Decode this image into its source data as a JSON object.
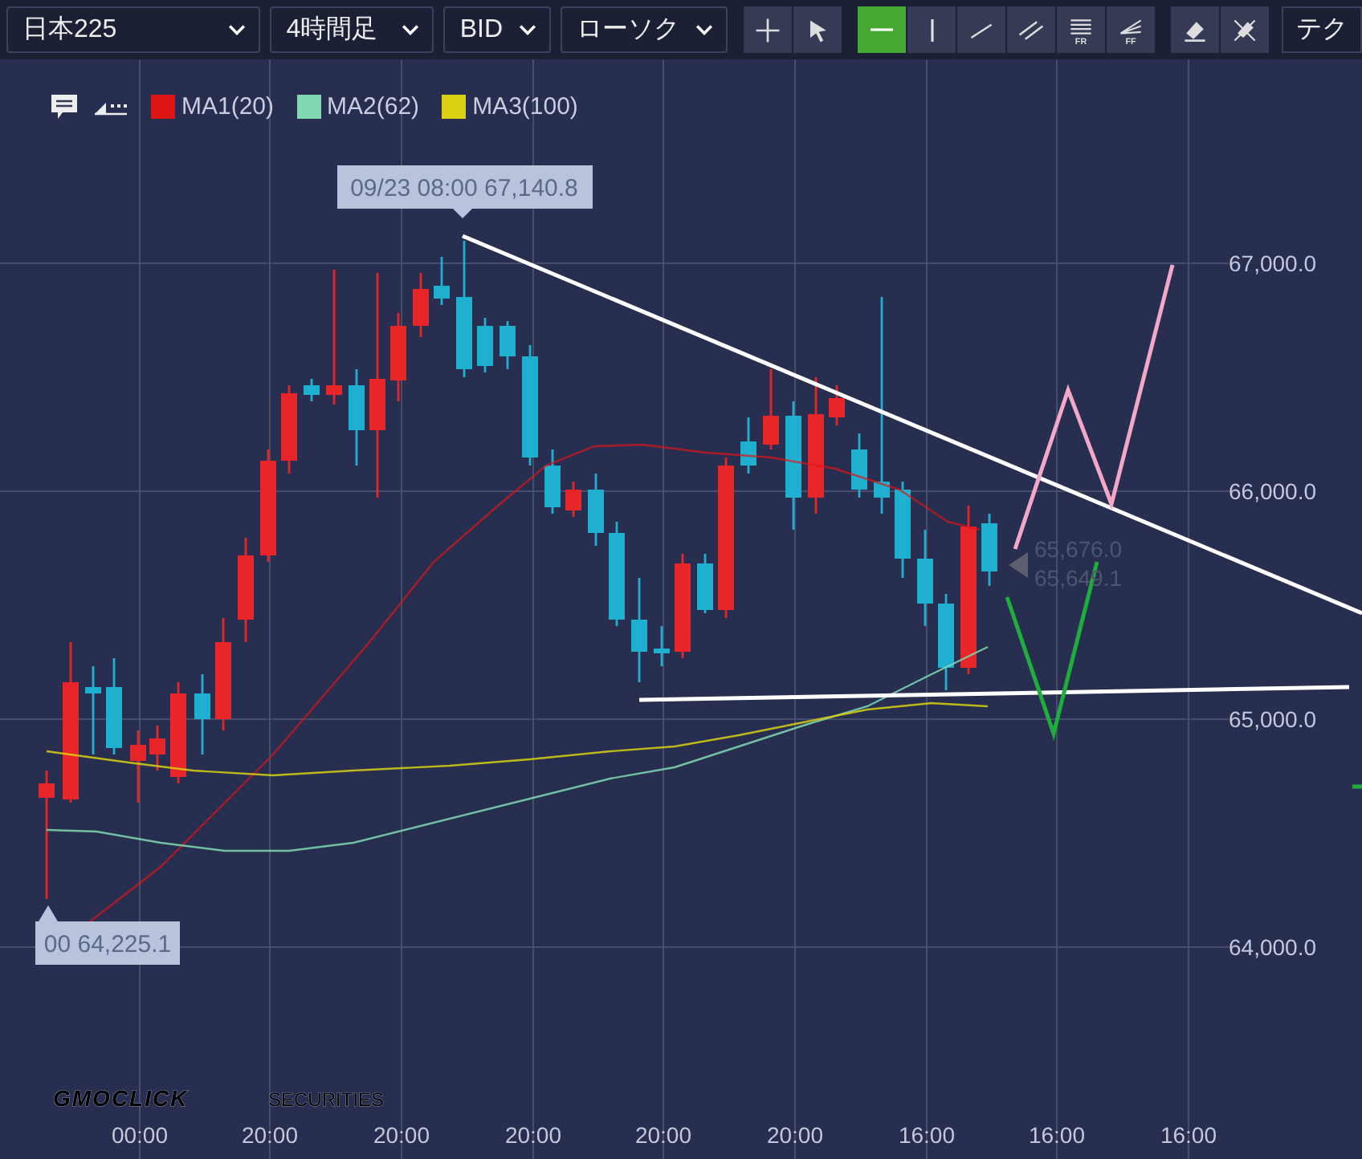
{
  "toolbar": {
    "dropdowns": [
      {
        "label": "日本225"
      },
      {
        "label": "4時間足"
      },
      {
        "label": "BID"
      },
      {
        "label": "ローソク"
      }
    ],
    "tool_groups": [
      {
        "tools": [
          {
            "kind": "crosshair",
            "selected": false
          },
          {
            "kind": "pointer",
            "selected": false
          }
        ]
      },
      {
        "tools": [
          {
            "kind": "hline",
            "selected": true
          },
          {
            "kind": "vline",
            "selected": false
          },
          {
            "kind": "trend",
            "selected": false
          },
          {
            "kind": "parallel",
            "selected": false
          },
          {
            "kind": "fibr",
            "label": "FR",
            "selected": false
          },
          {
            "kind": "fibf",
            "label": "FF",
            "selected": false
          }
        ]
      },
      {
        "tools": [
          {
            "kind": "eraser",
            "selected": false
          },
          {
            "kind": "clear",
            "selected": false
          }
        ]
      }
    ],
    "cut_button": {
      "label": "テク"
    }
  },
  "legend": [
    {
      "name": "MA1(20)",
      "color": "#e01515"
    },
    {
      "name": "MA2(62)",
      "color": "#7fd8b0"
    },
    {
      "name": "MA3(100)",
      "color": "#d8d010"
    }
  ],
  "chart": {
    "price_ticks": [
      "67,000.0",
      "66,000.0",
      "65,000.0",
      "64,000.0"
    ],
    "time_ticks": [
      "00:00",
      "20:00",
      "20:00",
      "20:00",
      "20:00",
      "20:00",
      "16:00",
      "16:00",
      "16:00"
    ],
    "high_label": "09/23 08:00 67,140.8",
    "low_label": "00 64,225.1",
    "last_prices": [
      "65,676.0",
      "65,649.1"
    ]
  },
  "logo": {
    "brand": "GMOCLICK",
    "suffix": "SECURITIES"
  }
}
